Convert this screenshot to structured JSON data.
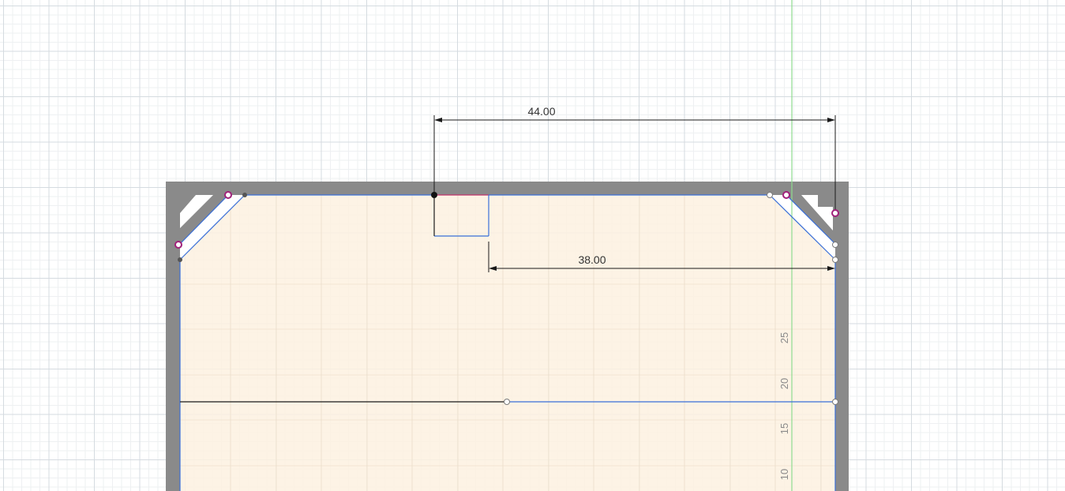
{
  "colors": {
    "frame": "#8a8a8a",
    "profile_fill": "#fdf1e0",
    "sketch_line": "#3a6fd8",
    "dimension_line": "#1a1a1a",
    "constraint_point": "#a0207a",
    "axis_line": "#8fdc8f"
  },
  "dimensions": {
    "top_width": "44.00",
    "slot_offset": "38.00"
  },
  "ruler": {
    "labels": [
      "25",
      "20",
      "15",
      "10"
    ]
  }
}
